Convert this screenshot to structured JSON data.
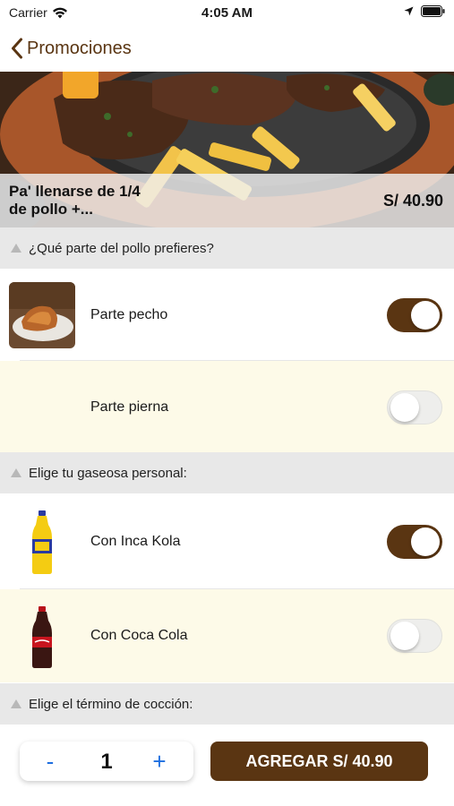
{
  "status_bar": {
    "carrier": "Carrier",
    "time": "4:05 AM",
    "icons": [
      "wifi-icon",
      "location-arrow-icon",
      "battery-icon"
    ]
  },
  "nav": {
    "back_label": "Promociones",
    "back_icon": "chevron-left-icon"
  },
  "product": {
    "title": "Pa' llenarse de 1/4 de pollo +...",
    "price": "S/ 40.90"
  },
  "sections": [
    {
      "title": "¿Qué parte del pollo prefieres?",
      "options": [
        {
          "label": "Parte pecho",
          "selected": true
        },
        {
          "label": "Parte pierna",
          "selected": false
        }
      ]
    },
    {
      "title": "Elige tu gaseosa personal:",
      "options": [
        {
          "label": "Con Inca Kola",
          "selected": true
        },
        {
          "label": "Con Coca Cola",
          "selected": false
        }
      ]
    },
    {
      "title": "Elige el término de cocción:",
      "options": []
    }
  ],
  "bottom_bar": {
    "minus": "-",
    "quantity": "1",
    "plus": "+",
    "add_label": "AGREGAR S/ 40.90"
  },
  "colors": {
    "brand_brown": "#5a3512",
    "section_bg": "#e8e8e8",
    "cream_row": "#fdfae8",
    "stepper_blue": "#1f6fe0"
  }
}
